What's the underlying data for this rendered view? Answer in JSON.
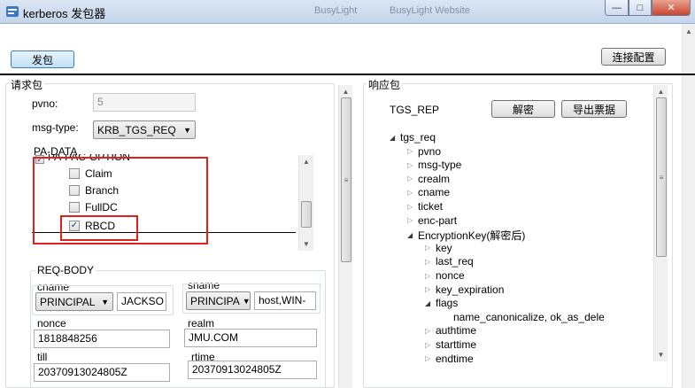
{
  "window": {
    "title": "kerberos 发包器",
    "background_tabs": [
      "BusyLight",
      "BusyLight Website"
    ],
    "controls": {
      "minimize": "—",
      "maximize": "□",
      "close": "✕"
    }
  },
  "toolbar": {
    "send_label": "发包",
    "connect_config_label": "连接配置"
  },
  "request": {
    "group_label": "请求包",
    "pvno_label": "pvno:",
    "pvno_value": "5",
    "msgtype_label": "msg-type:",
    "msgtype_value": "KRB_TGS_REQ",
    "padata": {
      "group_label": "PA-DATA",
      "option_label": "PA-PAC-OPTION",
      "items": [
        {
          "label": "Claim",
          "checked": false
        },
        {
          "label": "Branch",
          "checked": false
        },
        {
          "label": "FullDC",
          "checked": false
        },
        {
          "label": "RBCD",
          "checked": true
        }
      ]
    },
    "reqbody": {
      "group_label": "REQ-BODY",
      "cname_label": "cname",
      "cname_type": "PRINCIPAL",
      "cname_value": "JACKSO",
      "sname_label": "sname",
      "sname_type": "PRINCIPA",
      "sname_value": "host,WIN-",
      "nonce_label": "nonce",
      "nonce_value": "1818848256",
      "realm_label": "realm",
      "realm_value": "JMU.COM",
      "till_label": "till",
      "till_value": "20370913024805Z",
      "rtime_label": "rtime",
      "rtime_value": "20370913024805Z"
    }
  },
  "response": {
    "group_label": "响应包",
    "type_label": "TGS_REP",
    "decrypt_label": "解密",
    "export_label": "导出票据",
    "tree": [
      {
        "label": "tgs_req",
        "level": 0,
        "expanded": true
      },
      {
        "label": "pvno",
        "level": 1,
        "expanded": false
      },
      {
        "label": "msg-type",
        "level": 1,
        "expanded": false
      },
      {
        "label": "crealm",
        "level": 1,
        "expanded": false
      },
      {
        "label": "cname",
        "level": 1,
        "expanded": false
      },
      {
        "label": "ticket",
        "level": 1,
        "expanded": false
      },
      {
        "label": "enc-part",
        "level": 1,
        "expanded": false
      },
      {
        "label": "EncryptionKey(解密后)",
        "level": 1,
        "expanded": true
      },
      {
        "label": "key",
        "level": 2,
        "expanded": false
      },
      {
        "label": "last_req",
        "level": 2,
        "expanded": false
      },
      {
        "label": "nonce",
        "level": 2,
        "expanded": false
      },
      {
        "label": "key_expiration",
        "level": 2,
        "expanded": false
      },
      {
        "label": "flags",
        "level": 2,
        "expanded": true
      },
      {
        "label": "name_canonicalize, ok_as_dele",
        "level": 3,
        "leaf": true
      },
      {
        "label": "authtime",
        "level": 2,
        "expanded": false
      },
      {
        "label": "starttime",
        "level": 2,
        "expanded": false
      },
      {
        "label": "endtime",
        "level": 2,
        "expanded": false
      }
    ]
  },
  "colors": {
    "highlight_box": "#e0201a",
    "accent_button": "#bfe0f7"
  }
}
